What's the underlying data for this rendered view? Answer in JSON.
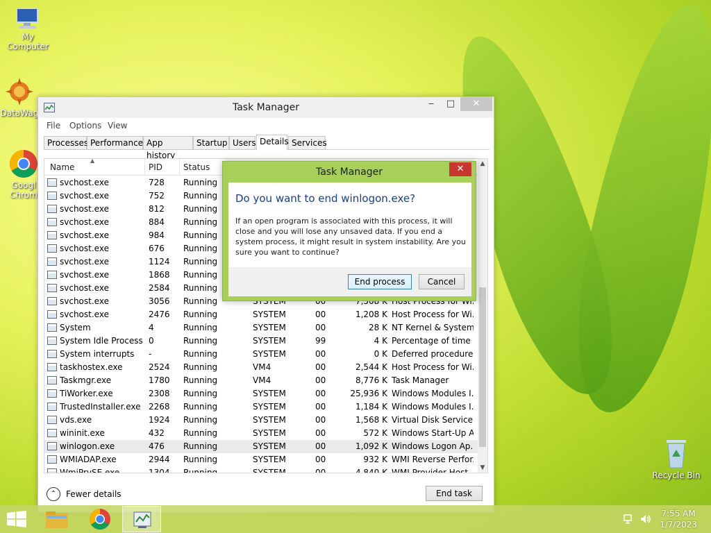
{
  "desktop": {
    "icons": [
      {
        "label": "My Computer"
      },
      {
        "label": "DataWag"
      },
      {
        "label": "Googl Chrom"
      },
      {
        "label": "Recycle Bin"
      }
    ]
  },
  "window": {
    "title": "Task Manager",
    "minimize_glyph": "‒",
    "maximize_glyph": "□",
    "close_glyph": "✕",
    "menu": [
      "File",
      "Options",
      "View"
    ],
    "tabs": [
      "Processes",
      "Performance",
      "App history",
      "Startup",
      "Users",
      "Details",
      "Services"
    ],
    "active_tab": "Details",
    "columns": {
      "name": "Name",
      "pid": "PID",
      "status": "Status"
    },
    "rows": [
      {
        "name": "svchost.exe",
        "pid": "728",
        "status": "Running",
        "user": "",
        "cpu": "",
        "mem": "",
        "desc": ""
      },
      {
        "name": "svchost.exe",
        "pid": "752",
        "status": "Running",
        "user": "",
        "cpu": "",
        "mem": "",
        "desc": ""
      },
      {
        "name": "svchost.exe",
        "pid": "812",
        "status": "Running",
        "user": "",
        "cpu": "",
        "mem": "",
        "desc": ""
      },
      {
        "name": "svchost.exe",
        "pid": "884",
        "status": "Running",
        "user": "",
        "cpu": "",
        "mem": "",
        "desc": ""
      },
      {
        "name": "svchost.exe",
        "pid": "984",
        "status": "Running",
        "user": "",
        "cpu": "",
        "mem": "",
        "desc": ""
      },
      {
        "name": "svchost.exe",
        "pid": "676",
        "status": "Running",
        "user": "",
        "cpu": "",
        "mem": "",
        "desc": ""
      },
      {
        "name": "svchost.exe",
        "pid": "1124",
        "status": "Running",
        "user": "",
        "cpu": "",
        "mem": "",
        "desc": ""
      },
      {
        "name": "svchost.exe",
        "pid": "1868",
        "status": "Running",
        "user": "",
        "cpu": "",
        "mem": "",
        "desc": ""
      },
      {
        "name": "svchost.exe",
        "pid": "2584",
        "status": "Running",
        "user": "",
        "cpu": "",
        "mem": "",
        "desc": ""
      },
      {
        "name": "svchost.exe",
        "pid": "3056",
        "status": "Running",
        "user": "SYSTEM",
        "cpu": "00",
        "mem": "7,508 K",
        "desc": "Host Process for Wi..."
      },
      {
        "name": "svchost.exe",
        "pid": "2476",
        "status": "Running",
        "user": "SYSTEM",
        "cpu": "00",
        "mem": "1,208 K",
        "desc": "Host Process for Wi..."
      },
      {
        "name": "System",
        "pid": "4",
        "status": "Running",
        "user": "SYSTEM",
        "cpu": "00",
        "mem": "28 K",
        "desc": "NT Kernel & System"
      },
      {
        "name": "System Idle Process",
        "pid": "0",
        "status": "Running",
        "user": "SYSTEM",
        "cpu": "99",
        "mem": "4 K",
        "desc": "Percentage of time t..."
      },
      {
        "name": "System interrupts",
        "pid": "-",
        "status": "Running",
        "user": "SYSTEM",
        "cpu": "00",
        "mem": "0 K",
        "desc": "Deferred procedure ..."
      },
      {
        "name": "taskhostex.exe",
        "pid": "2524",
        "status": "Running",
        "user": "VM4",
        "cpu": "00",
        "mem": "2,544 K",
        "desc": "Host Process for Wi..."
      },
      {
        "name": "Taskmgr.exe",
        "pid": "1780",
        "status": "Running",
        "user": "VM4",
        "cpu": "00",
        "mem": "8,776 K",
        "desc": "Task Manager"
      },
      {
        "name": "TiWorker.exe",
        "pid": "2308",
        "status": "Running",
        "user": "SYSTEM",
        "cpu": "00",
        "mem": "25,936 K",
        "desc": "Windows Modules I..."
      },
      {
        "name": "TrustedInstaller.exe",
        "pid": "2268",
        "status": "Running",
        "user": "SYSTEM",
        "cpu": "00",
        "mem": "1,184 K",
        "desc": "Windows Modules I..."
      },
      {
        "name": "vds.exe",
        "pid": "1924",
        "status": "Running",
        "user": "SYSTEM",
        "cpu": "00",
        "mem": "1,568 K",
        "desc": "Virtual Disk Service"
      },
      {
        "name": "wininit.exe",
        "pid": "432",
        "status": "Running",
        "user": "SYSTEM",
        "cpu": "00",
        "mem": "572 K",
        "desc": "Windows Start-Up A..."
      },
      {
        "name": "winlogon.exe",
        "pid": "476",
        "status": "Running",
        "user": "SYSTEM",
        "cpu": "00",
        "mem": "1,092 K",
        "desc": "Windows Logon Ap..."
      },
      {
        "name": "WMIADAP.exe",
        "pid": "2944",
        "status": "Running",
        "user": "SYSTEM",
        "cpu": "00",
        "mem": "932 K",
        "desc": "WMI Reverse Perfor..."
      },
      {
        "name": "WmiPrvSE.exe",
        "pid": "1304",
        "status": "Running",
        "user": "SYSTEM",
        "cpu": "00",
        "mem": "4,840 K",
        "desc": "WMI Provider Host"
      }
    ],
    "selected_row": "winlogon.exe",
    "footer": {
      "fewer_details": "Fewer details",
      "end_task": "End task"
    }
  },
  "dialog": {
    "title": "Task Manager",
    "close_glyph": "✕",
    "heading": "Do you want to end winlogon.exe?",
    "message": "If an open program is associated with this process, it will close and you will lose any unsaved data. If you end a system process, it might result in system instability. Are you sure you want to continue?",
    "end_process": "End process",
    "cancel": "Cancel"
  },
  "taskbar": {
    "time": "7:55 AM",
    "date": "1/7/2023"
  },
  "colors": {
    "dialog_frame": "#a8cf5a",
    "dialog_heading": "#1a3e8c",
    "close_red": "#c7372f"
  }
}
